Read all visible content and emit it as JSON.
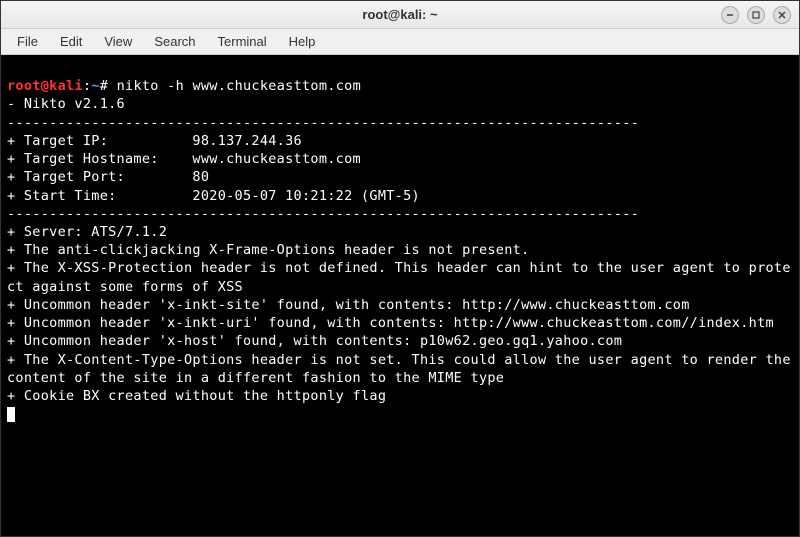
{
  "window": {
    "title": "root@kali: ~"
  },
  "menubar": {
    "items": [
      "File",
      "Edit",
      "View",
      "Search",
      "Terminal",
      "Help"
    ]
  },
  "terminal": {
    "prompt": {
      "userhost": "root@kali",
      "sep": ":",
      "path": "~",
      "symbol": "#"
    },
    "command": "nikto -h www.chuckeasttom.com",
    "lines": [
      "- Nikto v2.1.6",
      "---------------------------------------------------------------------------",
      "+ Target IP:          98.137.244.36",
      "+ Target Hostname:    www.chuckeasttom.com",
      "+ Target Port:        80",
      "+ Start Time:         2020-05-07 10:21:22 (GMT-5)",
      "---------------------------------------------------------------------------",
      "+ Server: ATS/7.1.2",
      "+ The anti-clickjacking X-Frame-Options header is not present.",
      "+ The X-XSS-Protection header is not defined. This header can hint to the user agent to protect against some forms of XSS",
      "+ Uncommon header 'x-inkt-site' found, with contents: http://www.chuckeasttom.com",
      "+ Uncommon header 'x-inkt-uri' found, with contents: http://www.chuckeasttom.com//index.htm",
      "+ Uncommon header 'x-host' found, with contents: p10w62.geo.gq1.yahoo.com",
      "+ The X-Content-Type-Options header is not set. This could allow the user agent to render the content of the site in a different fashion to the MIME type",
      "+ Cookie BX created without the httponly flag"
    ]
  }
}
